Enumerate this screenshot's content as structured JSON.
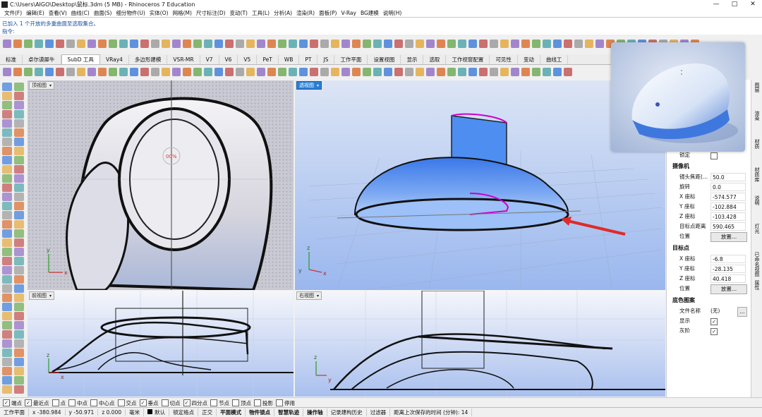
{
  "window": {
    "title": "C:\\Users\\AIGO\\Desktop\\鼠标.3dm (5 MB) - Rhinoceros 7 Education",
    "minimize": "—",
    "maximize": "□",
    "close": "✕"
  },
  "menu": [
    "文件(F)",
    "编辑(E)",
    "查看(V)",
    "曲线(C)",
    "曲面(S)",
    "细分物件(U)",
    "实体(O)",
    "网格(M)",
    "尺寸标注(D)",
    "变动(T)",
    "工具(L)",
    "分析(A)",
    "渲染(R)",
    "面板(P)",
    "V-Ray",
    "BG建模",
    "说明(H)"
  ],
  "command_history": {
    "line1": "已加入 1 个开放的多重曲面至选取集合。",
    "line2": "指令:"
  },
  "tabs": [
    {
      "label": "标准"
    },
    {
      "label": "卓尔谟犀牛"
    },
    {
      "label": "SubD 工具",
      "active": true
    },
    {
      "label": "VRay4"
    },
    {
      "label": "多边形建模"
    },
    {
      "label": "VSR-MR"
    },
    {
      "label": "V7"
    },
    {
      "label": "V6"
    },
    {
      "label": "V5"
    },
    {
      "label": "PeT"
    },
    {
      "label": "WB"
    },
    {
      "label": "PT"
    },
    {
      "label": "JS"
    },
    {
      "label": "工作平面"
    },
    {
      "label": "设置视图"
    },
    {
      "label": "显示"
    },
    {
      "label": "选取"
    },
    {
      "label": "工作视窗配置"
    },
    {
      "label": "可见性"
    },
    {
      "label": "变动"
    },
    {
      "label": "曲线工"
    }
  ],
  "viewports": {
    "top": {
      "label": "顶视图",
      "center_text": "00%"
    },
    "perspective": {
      "label": "透视图"
    },
    "front": {
      "label": "前视图"
    },
    "right": {
      "label": "右视图"
    },
    "axis_x": "x",
    "axis_y": "y",
    "axis_z": "z"
  },
  "properties": {
    "lock_label": "锁定",
    "camera_header": "摄像机",
    "lens_label": "镜头焦距(...",
    "lens_value": "50.0",
    "rotation_label": "旋转",
    "rotation_value": "0.0",
    "cam_x_label": "X 座标",
    "cam_x_value": "-574.577",
    "cam_y_label": "Y 座标",
    "cam_y_value": "-102.884",
    "cam_z_label": "Z 座标",
    "cam_z_value": "-103.428",
    "target_dist_label": "目标点距离",
    "target_dist_value": "590.465",
    "position_label": "位置",
    "place_button": "放置...",
    "target_header": "目标点",
    "tgt_x_label": "X 座标",
    "tgt_x_value": "-6.8",
    "tgt_y_label": "Y 座标",
    "tgt_y_value": "-28.135",
    "tgt_z_label": "Z 座标",
    "tgt_z_value": "40.418",
    "tgt_position_label": "位置",
    "tgt_place_button": "放置...",
    "bg_header": "底色图案",
    "filename_label": "文件名称",
    "filename_value": "(无)",
    "browse_button": "...",
    "show_label": "显示",
    "gray_label": "灰阶"
  },
  "side_tabs": [
    "图层",
    "渲染",
    "材质",
    "材质库",
    "说明",
    "灯光",
    "已命名视图",
    "属性"
  ],
  "osnaps": [
    {
      "label": "端点",
      "checked": true
    },
    {
      "label": "最近点",
      "checked": true
    },
    {
      "label": "点",
      "checked": false
    },
    {
      "label": "中点",
      "checked": false
    },
    {
      "label": "中心点",
      "checked": false
    },
    {
      "label": "交点",
      "checked": false
    },
    {
      "label": "垂点",
      "checked": true
    },
    {
      "label": "切点",
      "checked": false
    },
    {
      "label": "四分点",
      "checked": true
    },
    {
      "label": "节点",
      "checked": false
    },
    {
      "label": "顶点",
      "checked": false
    },
    {
      "label": "投影",
      "checked": false
    },
    {
      "label": "停用",
      "checked": false
    }
  ],
  "status": {
    "cplane": "工作平面",
    "x": "x -380.984",
    "y": "y -50.971",
    "z": "z 0.000",
    "units": "毫米",
    "layer": "默认",
    "grid_snap": "锁定格点",
    "ortho": "正交",
    "planar": "平面模式",
    "osnap": "物件锁点",
    "smarttrack": "智慧轨迹",
    "gumball": "操作轴",
    "history": "记录建构历史",
    "filter": "过滤器",
    "autosave": "距离上次保存的时间 (分钟): 14"
  },
  "colors": {
    "viewport_blue_top": "#cfdbf2",
    "viewport_blue_bottom": "#8fb0ec",
    "active_label": "#2a7fd4",
    "arrow": "#e02a2a"
  }
}
